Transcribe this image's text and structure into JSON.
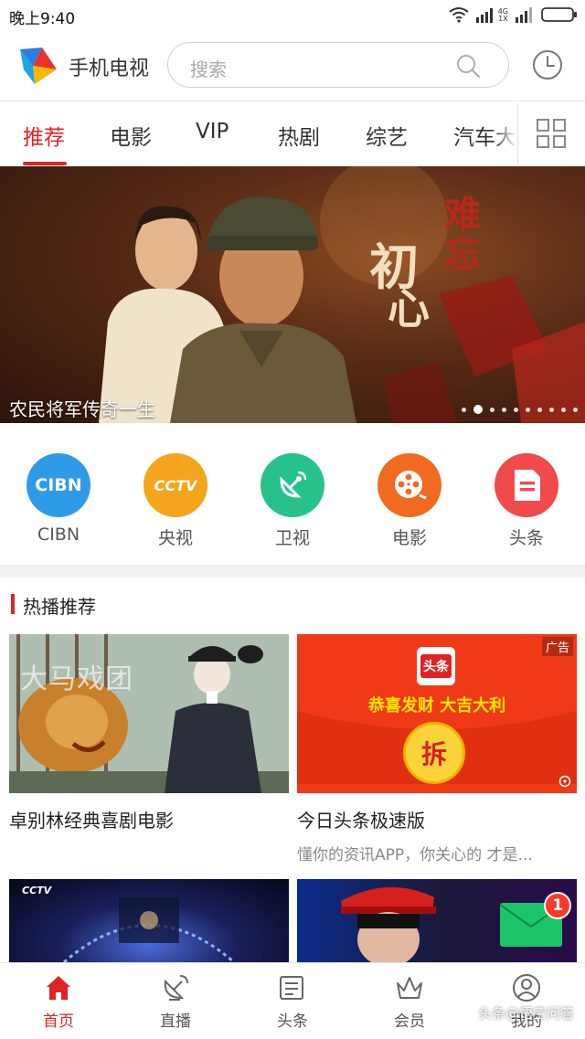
{
  "status_bar": {
    "time": "晚上9:40",
    "net_a": "4G",
    "net_b": "1X"
  },
  "header": {
    "app_title": "手机电视",
    "search_placeholder": "搜索"
  },
  "tabs": [
    {
      "label": "推荐",
      "active": true
    },
    {
      "label": "电影"
    },
    {
      "label": "VIP"
    },
    {
      "label": "热剧"
    },
    {
      "label": "综艺"
    },
    {
      "label": "汽车大"
    }
  ],
  "banner": {
    "caption": "农民将军传奇一生",
    "art_text_1": "难",
    "art_text_2": "忘",
    "art_text_3": "初",
    "art_text_4": "心",
    "dots_total": 10,
    "active_dot": 1
  },
  "categories": [
    {
      "label": "CIBN",
      "icon_text": "CIBN",
      "color": "#2f9be8"
    },
    {
      "label": "央视",
      "icon_text": "CCTV",
      "color": "#f4a51c"
    },
    {
      "label": "卫视",
      "icon_text": "",
      "color": "#27c28a"
    },
    {
      "label": "电影",
      "icon_text": "",
      "color": "#f06b1f"
    },
    {
      "label": "头条",
      "icon_text": "",
      "color": "#f04a4a"
    }
  ],
  "hot": {
    "section_title": "热播推荐",
    "cards": [
      {
        "title": "卓别林经典喜剧电影",
        "subtitle": "",
        "image_text": "大马戏团"
      },
      {
        "title": "今日头条极速版",
        "subtitle": "懂你的资讯APP，你关心的 才是...",
        "ad_badge": "广告",
        "ad_logo": "头条",
        "ad_tagline": "恭喜发财 大吉大利",
        "ad_button": "拆"
      },
      {
        "title": "",
        "image_text": "CCTV"
      },
      {
        "title": "",
        "notification_count": "1"
      }
    ]
  },
  "bottom_nav": [
    {
      "label": "首页",
      "active": true
    },
    {
      "label": "直播"
    },
    {
      "label": "头条"
    },
    {
      "label": "会员"
    },
    {
      "label": "我的"
    }
  ],
  "watermark": "头条@悟空问答",
  "colors": {
    "accent": "#e02424",
    "ad_red": "#f03a17"
  }
}
